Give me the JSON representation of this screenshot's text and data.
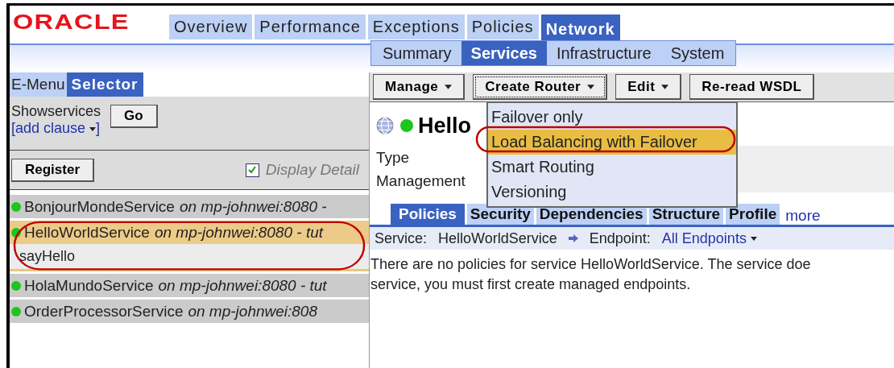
{
  "logo": "ORACLE",
  "main_tabs": [
    {
      "label": "Overview",
      "selected": false
    },
    {
      "label": "Performance",
      "selected": false
    },
    {
      "label": "Exceptions",
      "selected": false
    },
    {
      "label": "Policies",
      "selected": false
    },
    {
      "label": "Network",
      "selected": true
    }
  ],
  "sub_tabs": [
    {
      "label": "Summary",
      "selected": false
    },
    {
      "label": "Services",
      "selected": true
    },
    {
      "label": "Infrastructure",
      "selected": false
    },
    {
      "label": "System",
      "selected": false
    }
  ],
  "left_tabs": [
    {
      "label": "E-Menu",
      "selected": false
    },
    {
      "label": "Selector",
      "selected": true
    }
  ],
  "filter": {
    "label": "Showservices",
    "go_button": "Go",
    "add_clause": "[add clause",
    "add_clause_end": "]"
  },
  "register_button": "Register",
  "display_detail": {
    "label": "Display Detail",
    "checked": true
  },
  "services": [
    {
      "name": "BonjourMondeService",
      "host": "on mp-johnwei:8080 -",
      "online": true,
      "selected": false,
      "highlighted": false
    },
    {
      "name": "HelloWorldService",
      "host": "on mp-johnwei:8080 - tut",
      "online": true,
      "selected": true,
      "highlighted": true,
      "operations": [
        "sayHello"
      ]
    },
    {
      "name": "HolaMundoService",
      "host": "on mp-johnwei:8080 - tut",
      "online": true,
      "selected": false,
      "highlighted": false
    },
    {
      "name": "OrderProcessorService",
      "host": "on mp-johnwei:808",
      "online": true,
      "selected": false,
      "highlighted": false
    }
  ],
  "toolbar": [
    {
      "label": "Manage",
      "dropdown": true,
      "focused": false
    },
    {
      "label": "Create Router",
      "dropdown": true,
      "focused": true
    },
    {
      "label": "Edit",
      "dropdown": true,
      "focused": false
    },
    {
      "label": "Re-read WSDL",
      "dropdown": false,
      "focused": false
    }
  ],
  "router_menu": [
    {
      "label": "Failover only",
      "highlighted": false
    },
    {
      "label": "Load Balancing with Failover",
      "highlighted": true
    },
    {
      "label": "Smart Routing",
      "highlighted": false
    },
    {
      "label": "Versioning",
      "highlighted": false
    }
  ],
  "detail": {
    "title": "Hello",
    "online": true,
    "fields": [
      "Type",
      "Management"
    ]
  },
  "detail_tabs": [
    {
      "label": "Policies",
      "selected": true
    },
    {
      "label": "Security",
      "selected": false
    },
    {
      "label": "Dependencies",
      "selected": false
    },
    {
      "label": "Structure",
      "selected": false
    },
    {
      "label": "Profile",
      "selected": false
    }
  ],
  "more_link": "more",
  "context": {
    "service_label": "Service:",
    "service": "HelloWorldService",
    "endpoint_label": "Endpoint:",
    "endpoint": "All Endpoints"
  },
  "message": [
    "There are no policies for service HelloWorldService. The service doe",
    "service, you must first create managed endpoints."
  ]
}
